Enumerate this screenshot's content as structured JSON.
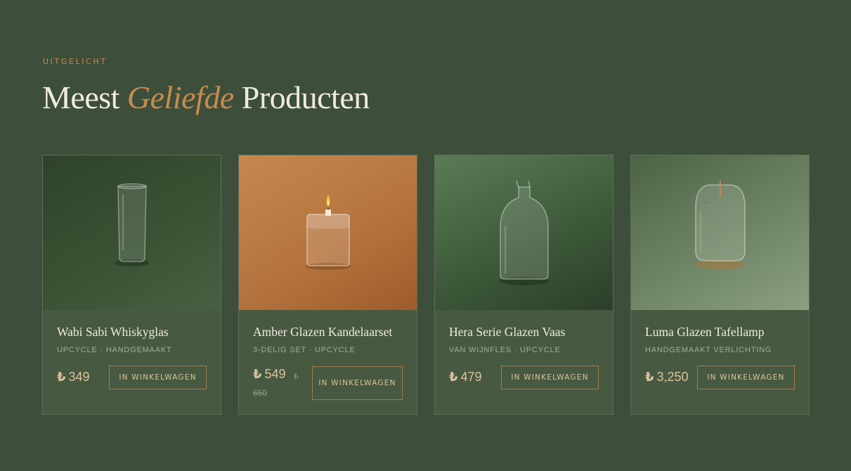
{
  "section": {
    "eyebrow": "UITGELICHT",
    "title_before": "Meest",
    "title_accent": "Geliefde",
    "title_after": "Producten",
    "accent_color": "#c98a4e"
  },
  "products": [
    {
      "name": "Wabi Sabi Whiskyglas",
      "tags": "UPCYCLE · HANDGEMAAKT",
      "currency": "₺",
      "price": "349",
      "button": "IN WINKELWAGEN",
      "icon": "whisky-glass-icon"
    },
    {
      "name": "Amber Glazen Kandelaarset",
      "tags": "3-DELIG SET · UPCYCLE",
      "currency": "₺",
      "price": "549",
      "old_currency": "₺",
      "old_price": "650",
      "button": "IN WINKELWAGEN",
      "icon": "candle-holder-icon"
    },
    {
      "name": "Hera Serie Glazen Vaas",
      "tags": "VAN WIJNFLES · UPCYCLE",
      "currency": "₺",
      "price": "479",
      "button": "IN WINKELWAGEN",
      "icon": "bottle-vase-icon"
    },
    {
      "name": "Luma Glazen Tafellamp",
      "tags": "HANDGEMAAKT VERLICHTING",
      "currency": "₺",
      "price": "3,250",
      "button": "IN WINKELWAGEN",
      "icon": "table-lamp-icon"
    }
  ]
}
